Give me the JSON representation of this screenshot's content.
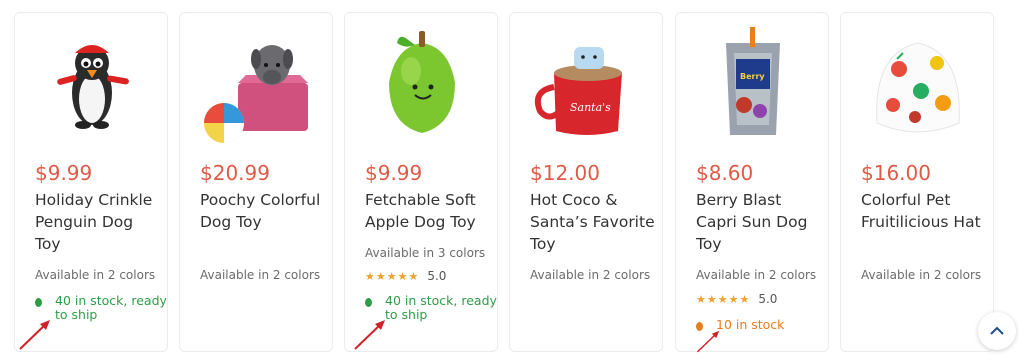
{
  "products": [
    {
      "price": "$9.99",
      "title": "Holiday Crinkle Penguin Dog Toy",
      "colors": "Available in 2 colors",
      "stock": "40 in stock, ready to ship",
      "stock_color": "#2f9d48"
    },
    {
      "price": "$20.99",
      "title": "Poochy Colorful Dog Toy",
      "colors": "Available in 2 colors"
    },
    {
      "price": "$9.99",
      "title": "Fetchable Soft Apple Dog Toy",
      "colors": "Available in 3 colors",
      "rating": "5.0",
      "stars": "★★★★★",
      "stock": "40 in stock, ready to ship",
      "stock_color": "#2f9d48"
    },
    {
      "price": "$12.00",
      "title": "Hot Coco & Santa’s Favorite Toy",
      "colors": "Available in 2 colors"
    },
    {
      "price": "$8.60",
      "title": "Berry Blast Capri Sun Dog Toy",
      "colors": "Available in 2 colors",
      "rating": "5.0",
      "stars": "★★★★★",
      "stock": "10 in stock",
      "stock_color": "#e67e22"
    },
    {
      "price": "$16.00",
      "title": "Colorful Pet Fruitilicious Hat",
      "colors": "Available in 2 colors"
    }
  ],
  "icons": {
    "scroll_top": "chevron-up-icon",
    "annotation": "red-arrow-icon"
  },
  "colors": {
    "price": "#e05a47",
    "star": "#f0a030",
    "border": "#ececec",
    "annotation": "#d0202a"
  }
}
